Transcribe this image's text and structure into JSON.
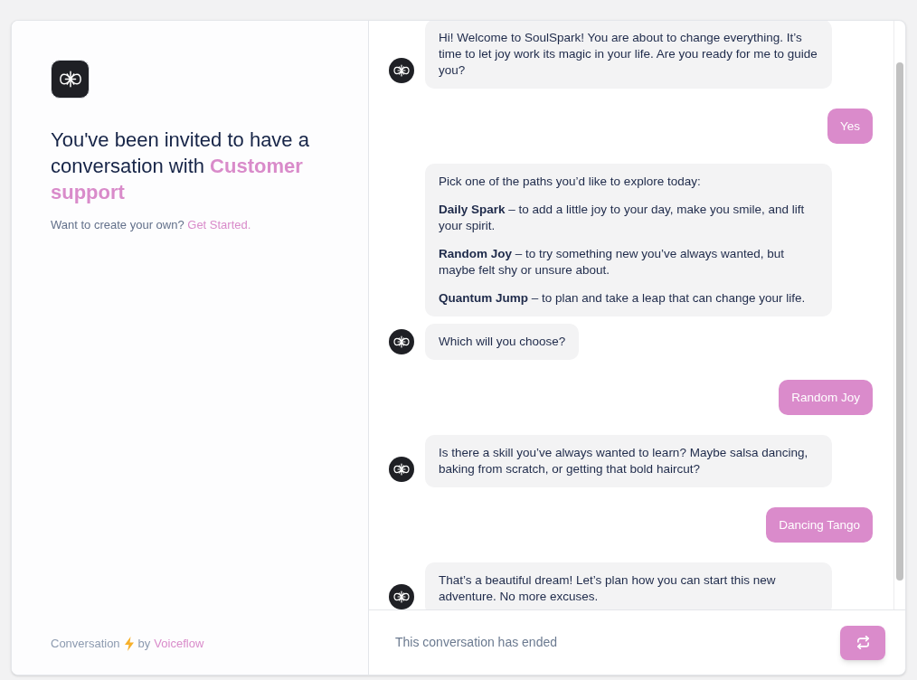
{
  "invite": {
    "heading": "You've been invited to have a conversation with **Customer support**",
    "prompt": "Want to create your own?",
    "link": "Get Started."
  },
  "footer": {
    "label": "Conversation",
    "by": "by",
    "link": "Voiceflow"
  },
  "chat": {
    "messages": [
      {
        "kind": "bot",
        "bubbles": [
          {
            "paragraphs": [
              "Hi! Welcome to SoulSpark! You are about to change everything. It’s time to let joy work its magic in your life. Are you ready for me to guide you?"
            ]
          }
        ]
      },
      {
        "kind": "user",
        "text": "Yes"
      },
      {
        "kind": "bot",
        "bubbles": [
          {
            "paragraphs": [
              "Pick one of the paths you’d like to explore today:",
              "**Daily Spark** – to add a little joy to your day, make you smile, and lift your spirit.",
              "**Random Joy** – to try something new you’ve always wanted, but maybe felt shy or unsure about.",
              "**Quantum Jump** – to plan and take a leap that can change your life."
            ]
          },
          {
            "paragraphs": [
              "Which will you choose?"
            ]
          }
        ]
      },
      {
        "kind": "user",
        "text": "Random Joy"
      },
      {
        "kind": "bot",
        "bubbles": [
          {
            "paragraphs": [
              "Is there a skill you’ve always wanted to learn? Maybe salsa dancing, baking from scratch, or getting that bold haircut?"
            ]
          }
        ]
      },
      {
        "kind": "user",
        "text": "Dancing Tango"
      },
      {
        "kind": "bot",
        "bubbles": [
          {
            "paragraphs": [
              "That’s a beautiful dream! Let’s plan how you can start this new adventure. No more excuses."
            ]
          }
        ]
      }
    ],
    "status": "This conversation has ended"
  }
}
